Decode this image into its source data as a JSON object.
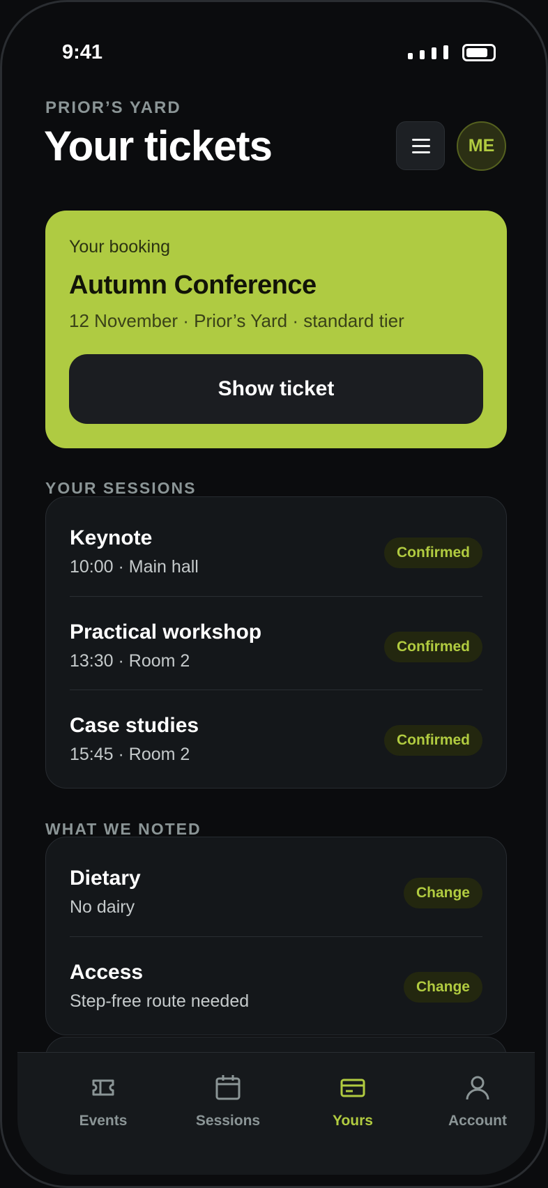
{
  "status_bar": {
    "time": "9:41"
  },
  "header": {
    "venue": "PRIOR’S YARD",
    "title": "Your tickets",
    "avatar_initials": "ME"
  },
  "booking": {
    "eyebrow": "Your booking",
    "event_name": "Autumn Conference",
    "meta": "12 November · Prior’s Yard · standard tier",
    "show_ticket_label": "Show ticket"
  },
  "sessions": {
    "label": "YOUR SESSIONS",
    "items": [
      {
        "title": "Keynote",
        "detail": "10:00 · Main hall",
        "status": "Confirmed"
      },
      {
        "title": "Practical workshop",
        "detail": "13:30 · Room 2",
        "status": "Confirmed"
      },
      {
        "title": "Case studies",
        "detail": "15:45 · Room 2",
        "status": "Confirmed"
      }
    ]
  },
  "noted": {
    "label": "WHAT WE NOTED",
    "items": [
      {
        "title": "Dietary",
        "detail": "No dairy",
        "action": "Change"
      },
      {
        "title": "Access",
        "detail": "Step-free route needed",
        "action": "Change"
      }
    ]
  },
  "tabbar": {
    "items": [
      {
        "label": "Events",
        "icon": "ticket-icon"
      },
      {
        "label": "Sessions",
        "icon": "calendar-icon"
      },
      {
        "label": "Yours",
        "icon": "card-icon",
        "active": true
      },
      {
        "label": "Account",
        "icon": "person-icon"
      }
    ]
  },
  "colors": {
    "accent": "#afcb42",
    "background": "#0b0c0e",
    "card": "#14171a",
    "muted_text": "#8b9596"
  }
}
